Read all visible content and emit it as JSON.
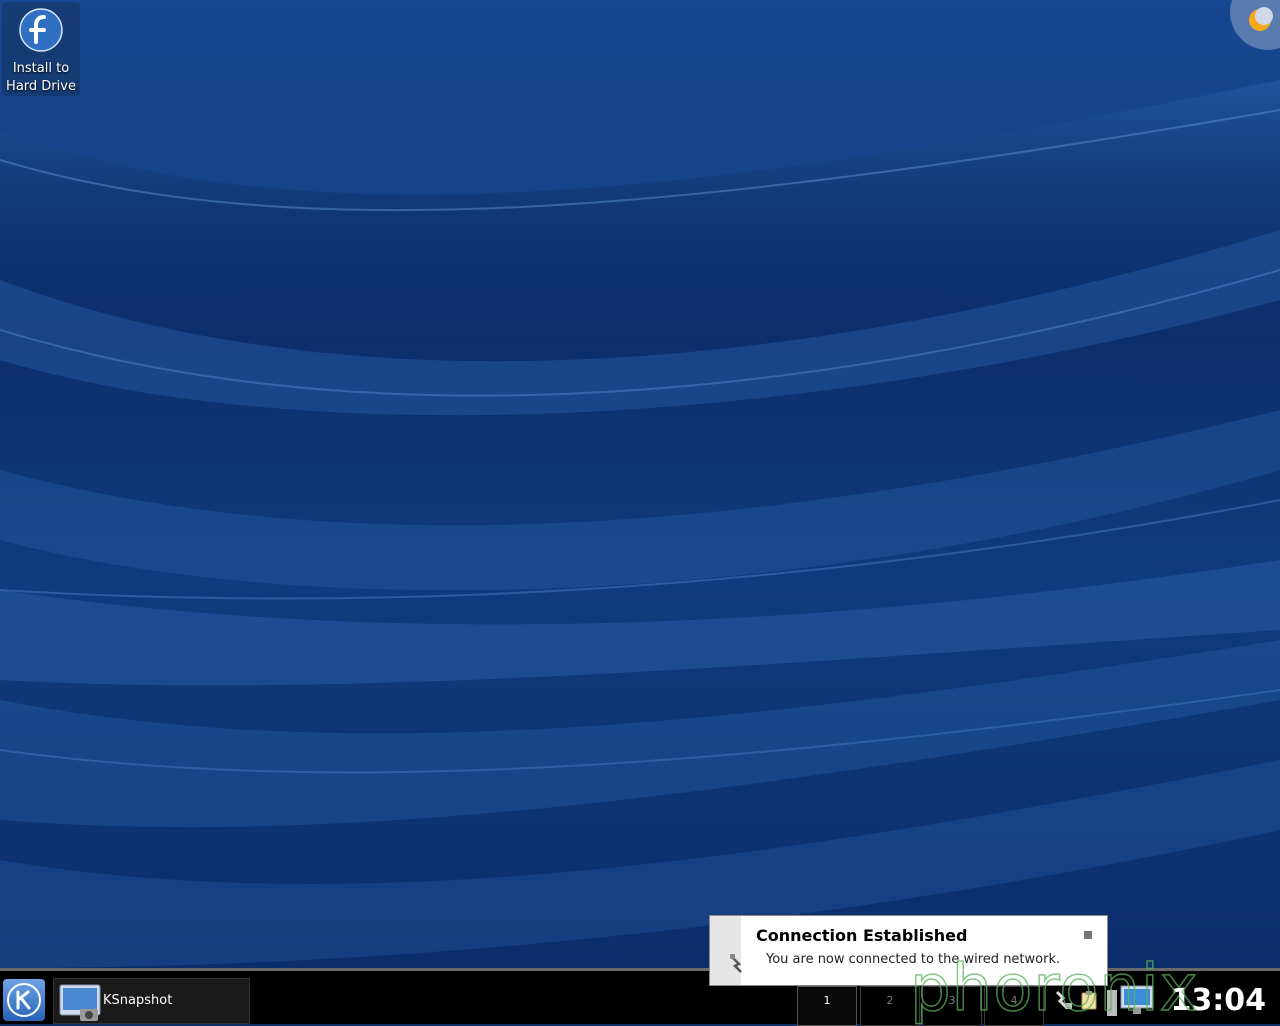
{
  "desktop": {
    "icons": [
      {
        "label_line1": "Install to",
        "label_line2": "Hard Drive",
        "icon": "fedora-logo-icon"
      }
    ],
    "corner_widget_icon": "plasma-cashew-icon"
  },
  "panel": {
    "start_icon": "kde-menu-icon",
    "tasks": [
      {
        "label": "KSnapshot",
        "icon": "ksnapshot-icon"
      }
    ],
    "pager": {
      "desktops": [
        "1",
        "2",
        "3",
        "4"
      ],
      "active": "1"
    },
    "tray": [
      {
        "icon": "network-icon"
      },
      {
        "icon": "clipboard-icon"
      },
      {
        "icon": "device-notifier-icon"
      }
    ],
    "clock": "13:04"
  },
  "notification": {
    "title": "Connection Established",
    "message": "You are now connected to the wired network.",
    "icon": "network-wired-icon"
  },
  "watermark": "phoronix",
  "colors": {
    "wallpaper_blue": "#0e2f66",
    "panel_bg": "#000000",
    "watermark_green": "#5ab45a"
  }
}
